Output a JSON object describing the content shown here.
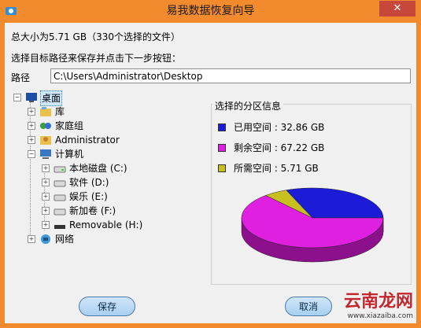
{
  "window": {
    "title": "易我数据恢复向导",
    "close_label": "✕"
  },
  "summary": {
    "total": "总大小为5.71 GB（330个选择的文件）",
    "instruction": "选择目标路径来保存并点击下一步按钮："
  },
  "path": {
    "label": "路径",
    "value": "C:\\Users\\Administrator\\Desktop"
  },
  "tree": {
    "root": "桌面",
    "items": [
      "库",
      "家庭组",
      "Administrator",
      "计算机",
      "本地磁盘 (C:)",
      "软件 (D:)",
      "娱乐 (E:)",
      "新加卷 (F:)",
      "Removable (H:)",
      "网络"
    ]
  },
  "partition": {
    "title": "选择的分区信息",
    "legend": [
      {
        "label": "已用空间 : 32.86 GB",
        "color": "#1c1cd6"
      },
      {
        "label": "剩余空间 : 67.22 GB",
        "color": "#e020e0"
      },
      {
        "label": "所需空间 : 5.71 GB",
        "color": "#c8c020"
      }
    ]
  },
  "chart_data": {
    "type": "pie",
    "categories": [
      "已用空间",
      "剩余空间",
      "所需空间"
    ],
    "values": [
      32.86,
      67.22,
      5.71
    ],
    "unit": "GB"
  },
  "buttons": {
    "save": "保存",
    "cancel": "取消"
  },
  "watermark": {
    "brand": "云南龙网",
    "url": "www.xiazaiba.com"
  },
  "colors": {
    "window_frame": "#f28a2e",
    "selection": "#cce8ff"
  }
}
